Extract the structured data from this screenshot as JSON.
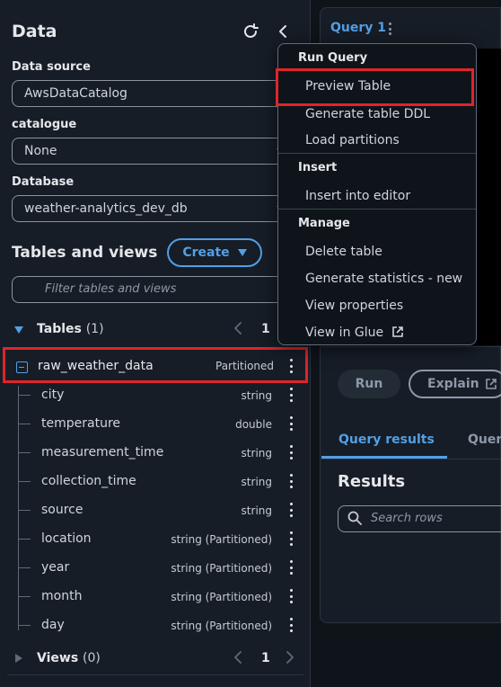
{
  "data_panel": {
    "title": "Data",
    "data_source_label": "Data source",
    "data_source_value": "AwsDataCatalog",
    "catalogue_label": "catalogue",
    "catalogue_value": "None",
    "database_label": "Database",
    "database_value": "weather-analytics_dev_db",
    "tables_views_heading": "Tables and views",
    "create_label": "Create",
    "filter_placeholder": "Filter tables and views",
    "tables_label": "Tables",
    "tables_count": "(1)",
    "tables_page": "1",
    "table": {
      "name": "raw_weather_data",
      "tag": "Partitioned",
      "columns": [
        {
          "name": "city",
          "type": "string"
        },
        {
          "name": "temperature",
          "type": "double"
        },
        {
          "name": "measurement_time",
          "type": "string"
        },
        {
          "name": "collection_time",
          "type": "string"
        },
        {
          "name": "source",
          "type": "string"
        },
        {
          "name": "location",
          "type": "string (Partitioned)"
        },
        {
          "name": "year",
          "type": "string (Partitioned)"
        },
        {
          "name": "month",
          "type": "string (Partitioned)"
        },
        {
          "name": "day",
          "type": "string (Partitioned)"
        }
      ]
    },
    "views_label": "Views",
    "views_count": "(0)",
    "views_page": "1"
  },
  "editor": {
    "query_tab_label": "Query 1",
    "run_label": "Run",
    "explain_label": "Explain",
    "tab_results": "Query results",
    "tab_other": "Quer",
    "results_heading": "Results",
    "search_rows_placeholder": "Search rows"
  },
  "context_menu": {
    "run_query_title": "Run Query",
    "preview_table": "Preview Table",
    "generate_ddl": "Generate table DDL",
    "load_partitions": "Load partitions",
    "insert_title": "Insert",
    "insert_into_editor": "Insert into editor",
    "manage_title": "Manage",
    "delete_table": "Delete table",
    "generate_statistics": "Generate statistics - new",
    "view_properties": "View properties",
    "view_in_glue": "View in Glue"
  },
  "colors": {
    "accent": "#539fe5",
    "highlight_red": "#e0242a",
    "panel_bg": "#161d26",
    "page_bg": "#0f141a"
  }
}
